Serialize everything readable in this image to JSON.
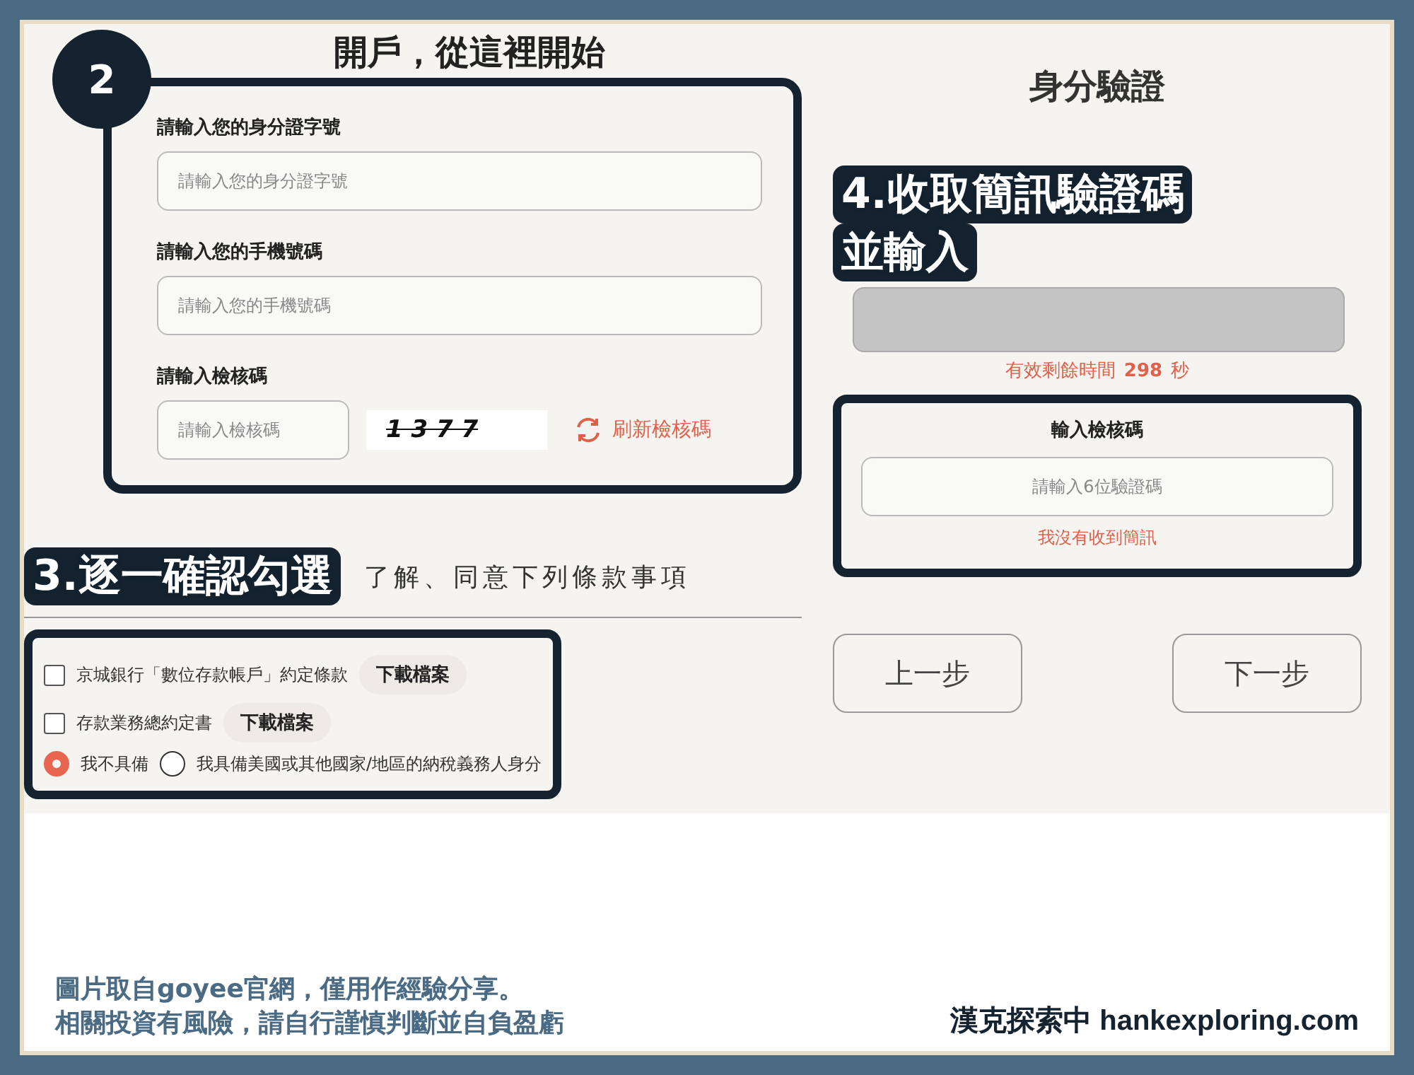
{
  "step_badge": "2",
  "left_title": "開戶，從這裡開始",
  "form_fields": [
    {
      "label": "請輸入您的身分證字號",
      "placeholder": "請輸入您的身分證字號"
    },
    {
      "label": "請輸入您的手機號碼",
      "placeholder": "請輸入您的手機號碼"
    }
  ],
  "captcha": {
    "label": "請輸入檢核碼",
    "placeholder": "請輸入檢核碼",
    "image_text": "1 3 7 7",
    "refresh": "刷新檢核碼"
  },
  "terms_annotation": "3.逐一確認勾選",
  "terms_heading": "了解、同意下列條款事項",
  "terms": [
    {
      "label": "京城銀行「數位存款帳戶」約定條款",
      "checked": false,
      "download": "下載檔案"
    },
    {
      "label": "存款業務總約定書",
      "checked": false,
      "download": "下載檔案"
    }
  ],
  "tax_options": [
    {
      "label": "我不具備",
      "selected": true
    },
    {
      "label": "我具備美國或其他國家/地區的納稅義務人身分",
      "selected": false
    }
  ],
  "right_title": "身分驗證",
  "sms_annotation": [
    "4.收取簡訊驗證碼",
    "並輸入"
  ],
  "timer": {
    "label": "有效剩餘時間",
    "seconds": "298",
    "unit": "秒"
  },
  "otp": {
    "label": "輸入檢核碼",
    "placeholder": "請輸入6位驗證碼",
    "resend_link": "我沒有收到簡訊"
  },
  "nav_buttons": [
    "上一步",
    "下一步"
  ],
  "caption": [
    "圖片取自goyee官網，僅用作經驗分享。",
    "相關投資有風險，請自行謹慎判斷並自負盈虧"
  ],
  "credit": "漢克探索中 hankexploring.com"
}
